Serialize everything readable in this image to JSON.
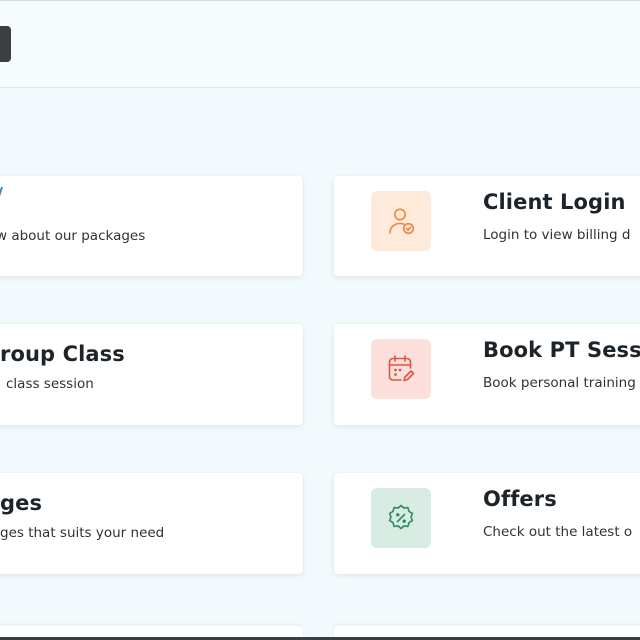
{
  "cards": {
    "packages_info": {
      "title": "",
      "desc": "w about our packages",
      "title_fragment": "/"
    },
    "client_login": {
      "title": "Client Login",
      "desc": "Login to view billing d",
      "icon": "user-check-icon",
      "icon_bg": "#fdeadb",
      "icon_color": "#f0843c"
    },
    "group_class": {
      "title": "roup Class",
      "desc": "class session"
    },
    "book_pt": {
      "title": "Book PT Sessi",
      "desc": "Book personal training",
      "icon": "calendar-edit-icon",
      "icon_bg": "#fbe0dc",
      "icon_color": "#e2553f"
    },
    "packages": {
      "title": "ges",
      "desc": "ges that suits your need"
    },
    "offers": {
      "title": "Offers",
      "desc": "Check out the latest o",
      "icon": "discount-badge-icon",
      "icon_bg": "#d9ece4",
      "icon_color": "#2f8a62"
    }
  },
  "colors": {
    "background": "#f3fafd",
    "card": "#ffffff",
    "text": "#1c2329"
  }
}
